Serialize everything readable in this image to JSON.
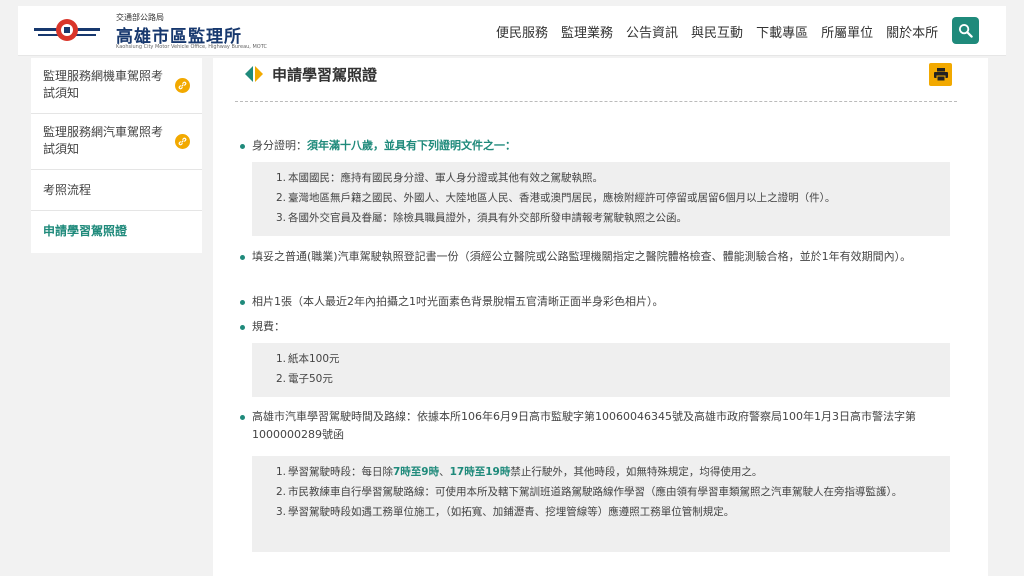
{
  "header": {
    "logo_small": "交通部公路局",
    "logo_big": "高雄市區監理所",
    "logo_en": "Kaohsiung City Motor Vehicle Office, Highway Bureau, MOTC",
    "nav": [
      "便民服務",
      "監理業務",
      "公告資訊",
      "與民互動",
      "下載專區",
      "所屬單位",
      "關於本所"
    ],
    "search_icon": "search-icon"
  },
  "sidebar": {
    "items": [
      {
        "label": "監理服務網機車駕照考試須知",
        "icon": "link-icon"
      },
      {
        "label": "監理服務網汽車駕照考試須知",
        "icon": "link-icon"
      },
      {
        "label": "考照流程"
      },
      {
        "label": "申請學習駕照證"
      }
    ]
  },
  "main": {
    "title": "申請學習駕照證",
    "print_icon": "printer-icon",
    "id_label": "身分證明：",
    "id_highlight": "須年滿十八歲，並具有下列證明文件之一：",
    "id_items": [
      "本國國民：應持有國民身分證、軍人身分證或其他有效之駕駛執照。",
      "臺灣地區無戶籍之國民、外國人、大陸地區人民、香港或澳門居民，應檢附經許可停留或居留6個月以上之證明（件）。",
      "各國外交官員及眷屬：除檢具職員證外，須具有外交部所發申請報考駕駛執照之公函。"
    ],
    "form_text": "填妥之普通(職業)汽車駕駛執照登記書一份（須經公立醫院或公路監理機關指定之醫院體格檢查、體能測驗合格，並於1年有效期間內）。",
    "photo_text": "相片1張（本人最近2年內拍攝之1吋光面素色背景脫帽五官清晰正面半身彩色相片）。",
    "fee_label": "規費：",
    "fee_items": [
      "紙本100元",
      "電子50元"
    ],
    "route_text": "高雄市汽車學習駕駛時間及路線：依據本所106年6月9日高市監駛字第10060046345號及高雄市政府警察局100年1月3日高市警法字第1000000289號函",
    "route_item1_prefix": "學習駕駛時段：每日除",
    "route_item1_t1": "7時至9時",
    "route_item1_sep": "、",
    "route_item1_t2": "17時至19時",
    "route_item1_suffix": "禁止行駛外，其他時段，如無特殊規定，均得使用之。",
    "route_item2": "市民教練車自行學習駕駛路線：可使用本所及轄下駕訓班道路駕駛路線作學習（應由領有學習車類駕照之汽車駕駛人在旁指導監護）。",
    "route_item3": "學習駕駛時段如遇工務單位施工，（如拓寬、加鋪瀝青、挖埋管線等）應遵照工務單位管制規定。"
  },
  "colors": {
    "accent": "#1f8a7b",
    "badge": "#f2a900",
    "logo_blue": "#17386e",
    "logo_red": "#d9352a"
  }
}
